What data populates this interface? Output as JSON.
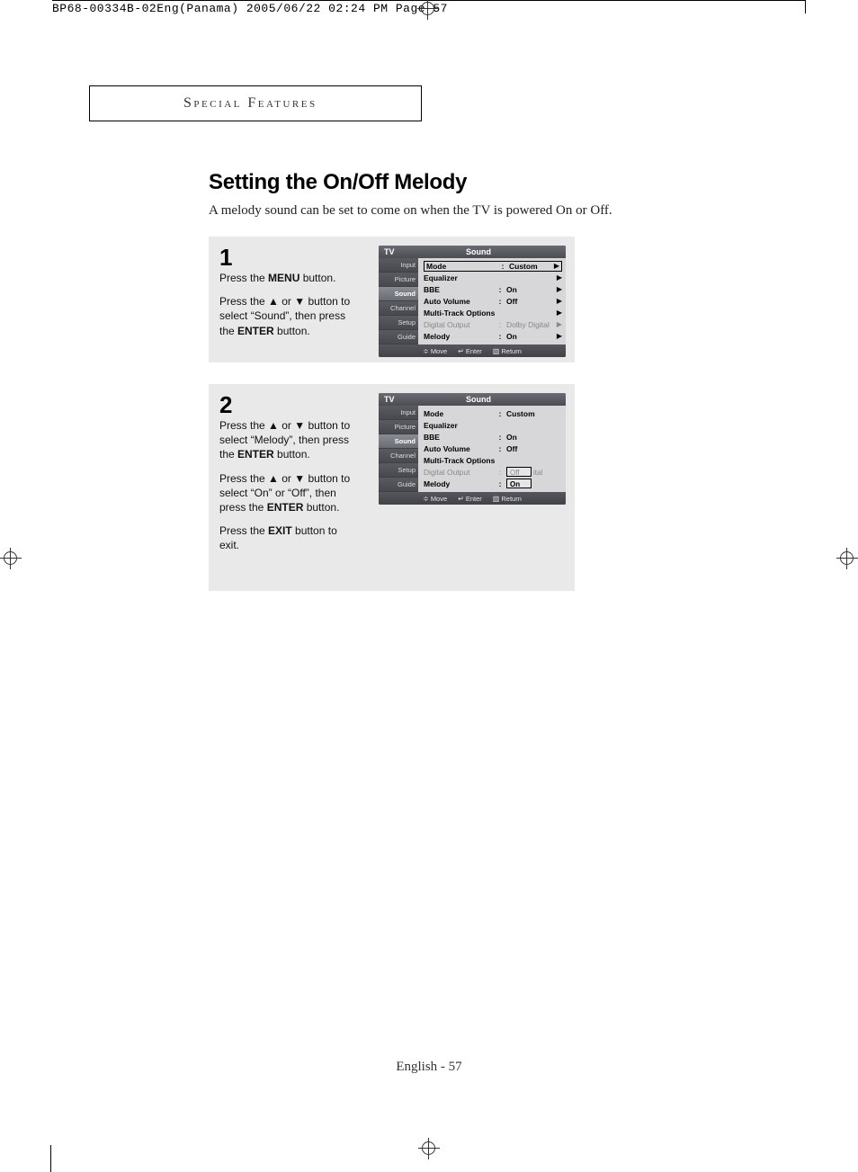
{
  "header": {
    "slug": "BP68-00334B-02Eng(Panama)  2005/06/22  02:24 PM  Page 57"
  },
  "section_label": "Special Features",
  "title": "Setting the On/Off Melody",
  "intro": "A melody sound can be set to come on when the TV is powered On or Off.",
  "steps": [
    {
      "num": "1",
      "paras": [
        "Press the <b>MENU</b> button.",
        "Press the ▲ or ▼ button to select “Sound”, then press the <b>ENTER</b> button."
      ]
    },
    {
      "num": "2",
      "paras": [
        "Press the ▲ or ▼ button to select “Melody”, then press the <b>ENTER</b> button.",
        "Press the ▲ or ▼ button to select “On” or “Off”, then press the <b>ENTER</b> button.",
        "Press the <b>EXIT</b> button to exit."
      ]
    }
  ],
  "osd_common": {
    "header_left": "TV",
    "header_center": "Sound",
    "tabs": [
      "Input",
      "Picture",
      "Sound",
      "Channel",
      "Setup",
      "Guide"
    ],
    "selected_tab": "Sound",
    "footer": {
      "move": "Move",
      "enter": "Enter",
      "return": "Return"
    }
  },
  "osd1": {
    "rows": [
      {
        "label": "Mode",
        "value": "Custom",
        "arrow": true,
        "boxed": true
      },
      {
        "label": "Equalizer",
        "value": "",
        "arrow": true
      },
      {
        "label": "BBE",
        "value": "On",
        "arrow": true
      },
      {
        "label": "Auto Volume",
        "value": "Off",
        "arrow": true
      },
      {
        "label": "Multi-Track Options",
        "value": "",
        "arrow": true
      },
      {
        "label": "Digital Output",
        "value": "Dolby Digital",
        "arrow": true,
        "dim": true
      },
      {
        "label": "Melody",
        "value": "On",
        "arrow": true
      }
    ]
  },
  "osd2": {
    "rows": [
      {
        "label": "Mode",
        "value": "Custom"
      },
      {
        "label": "Equalizer",
        "value": ""
      },
      {
        "label": "BBE",
        "value": "On"
      },
      {
        "label": "Auto Volume",
        "value": "Off"
      },
      {
        "label": "Multi-Track Options",
        "value": ""
      },
      {
        "label": "Digital Output",
        "value": "Off",
        "trailing": "ital",
        "dim": true,
        "dropdown": true
      },
      {
        "label": "Melody",
        "value": "On",
        "dropdown": true,
        "boxed_val": true
      }
    ]
  },
  "footer": "English - 57"
}
